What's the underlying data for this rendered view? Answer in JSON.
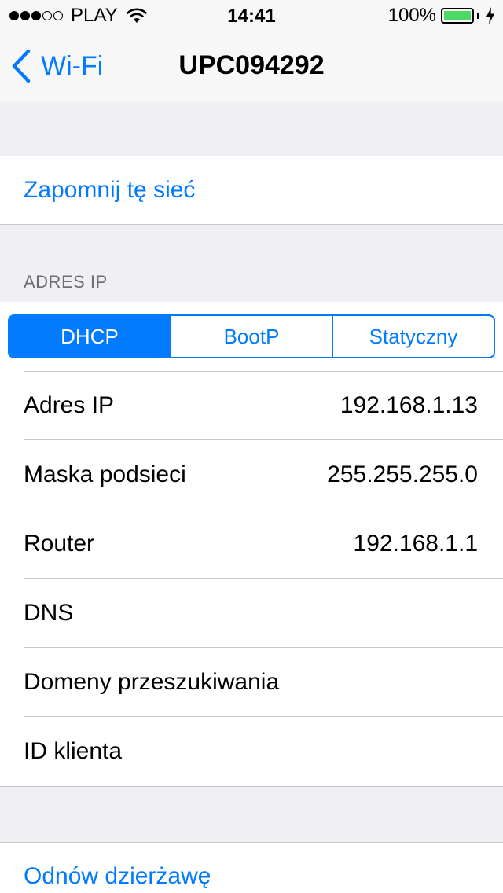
{
  "status_bar": {
    "signal_bars_full": 3,
    "signal_bars_total": 5,
    "carrier": "PLAY",
    "time": "14:41",
    "battery_percent_text": "100%",
    "battery_level": 1.0,
    "battery_color": "#4cd964",
    "icons": [
      "wifi-icon",
      "battery-icon",
      "charging-bolt-icon"
    ]
  },
  "nav": {
    "back_label": "Wi-Fi",
    "back_icon": "chevron-left-icon",
    "title": "UPC094292"
  },
  "actions": {
    "forget_network": "Zapomnij tę sieć",
    "renew_lease": "Odnów dzierżawę"
  },
  "ip_section": {
    "header": "ADRES IP",
    "segments": [
      "DHCP",
      "BootP",
      "Statyczny"
    ],
    "selected_segment": "DHCP",
    "rows": [
      {
        "label": "Adres IP",
        "value": "192.168.1.13"
      },
      {
        "label": "Maska podsieci",
        "value": "255.255.255.0"
      },
      {
        "label": "Router",
        "value": "192.168.1.1"
      },
      {
        "label": "DNS",
        "value": ""
      },
      {
        "label": "Domeny przeszukiwania",
        "value": ""
      },
      {
        "label": "ID klienta",
        "value": ""
      }
    ]
  },
  "colors": {
    "accent": "#007aff",
    "background": "#efeff4"
  }
}
